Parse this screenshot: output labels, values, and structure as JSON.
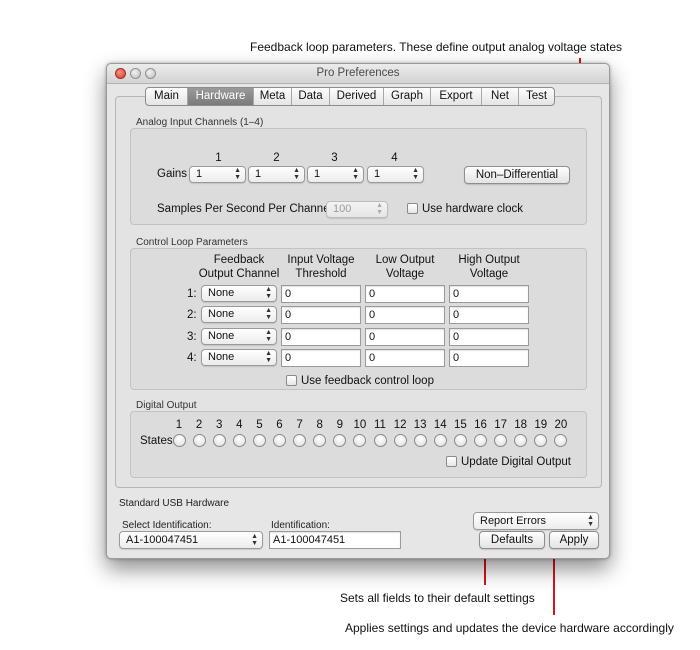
{
  "callouts": {
    "feedback": "Feedback loop parameters. These define output analog voltage states",
    "defaults": "Sets all fields to their default settings",
    "apply": "Applies settings and updates the device hardware accordingly"
  },
  "window": {
    "title": "Pro Preferences"
  },
  "tabs": [
    {
      "label": "Main",
      "selected": false
    },
    {
      "label": "Hardware",
      "selected": true
    },
    {
      "label": "Meta",
      "selected": false
    },
    {
      "label": "Data",
      "selected": false
    },
    {
      "label": "Derived",
      "selected": false
    },
    {
      "label": "Graph",
      "selected": false
    },
    {
      "label": "Export",
      "selected": false
    },
    {
      "label": "Net",
      "selected": false
    },
    {
      "label": "Test",
      "selected": false
    }
  ],
  "analog": {
    "group_label": "Analog Input Channels (1–4)",
    "gains_label": "Gains",
    "channels": [
      {
        "number": "1",
        "gain": "1"
      },
      {
        "number": "2",
        "gain": "1"
      },
      {
        "number": "3",
        "gain": "1"
      },
      {
        "number": "4",
        "gain": "1"
      }
    ],
    "non_differential_button": "Non–Differential",
    "samples_label": "Samples Per Second Per Channel:",
    "samples_value": "100",
    "hardware_clock_label": "Use hardware clock",
    "hardware_clock_checked": false
  },
  "control": {
    "group_label": "Control Loop Parameters",
    "headers": {
      "feedback": "Feedback\nOutput Channel",
      "input_threshold": "Input Voltage\nThreshold",
      "low_output": "Low Output\nVoltage",
      "high_output": "High Output\nVoltage"
    },
    "rows": [
      {
        "label": "1:",
        "channel": "None",
        "threshold": "0",
        "low": "0",
        "high": "0"
      },
      {
        "label": "2:",
        "channel": "None",
        "threshold": "0",
        "low": "0",
        "high": "0"
      },
      {
        "label": "3:",
        "channel": "None",
        "threshold": "0",
        "low": "0",
        "high": "0"
      },
      {
        "label": "4:",
        "channel": "None",
        "threshold": "0",
        "low": "0",
        "high": "0"
      }
    ],
    "use_feedback_label": "Use feedback control loop",
    "use_feedback_checked": false
  },
  "digital": {
    "group_label": "Digital Output",
    "states_label": "States:",
    "numbers": [
      "1",
      "2",
      "3",
      "4",
      "5",
      "6",
      "7",
      "8",
      "9",
      "10",
      "11",
      "12",
      "13",
      "14",
      "15",
      "16",
      "17",
      "18",
      "19",
      "20"
    ],
    "update_label": "Update Digital Output",
    "update_checked": false
  },
  "usb": {
    "section_label": "Standard USB Hardware",
    "select_id_label": "Select Identification:",
    "select_id_value": "A1-100047451",
    "id_label": "Identification:",
    "id_value": "A1-100047451",
    "report_select": "Report Errors",
    "defaults_button": "Defaults",
    "apply_button": "Apply"
  },
  "colors": {
    "callout_line": "#d8131b",
    "selected_tab": "#858585",
    "window_bg": "#e6e6e6"
  }
}
